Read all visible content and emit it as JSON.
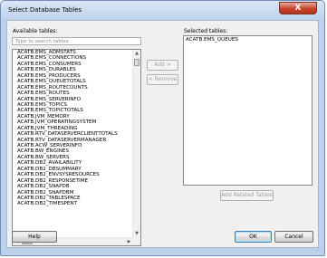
{
  "window": {
    "title": "Select Database Tables",
    "close_glyph": "X"
  },
  "available": {
    "label": "Available tables:",
    "search_placeholder": "Type to search tables",
    "items": [
      "ACATB.EMS_ADMSTATS",
      "ACATB.EMS_CONNECTIONS",
      "ACATB.EMS_CONSUMERS",
      "ACATB.EMS_DURABLES",
      "ACATB.EMS_PRODUCERS",
      "ACATB.EMS_QUEUETOTALS",
      "ACATB.EMS_ROUTECOUNTS",
      "ACATB.EMS_ROUTES",
      "ACATB.EMS_SERVERINFO",
      "ACATB.EMS_TOPICS",
      "ACATB.EMS_TOPICTOTALS",
      "ACATB.JVM_MEMORY",
      "ACATB.JVM_OPERATINGSYSTEM",
      "ACATB.JVM_THREADING",
      "ACATB.RTV_DATASERVERCLIENTTOTALS",
      "ACATB.RTV_DATASERVERMANAGER",
      "ACATB.ACW_SERVERINFO",
      "ACATB.BW_ENGINES",
      "ACATB.BW_SERVERS",
      "ACATB.DB2_AVAILABILITY",
      "ACATB.DB2_DBSUMMARY",
      "ACATB.DB2_ENVSYSRESOURCES",
      "ACATB.DB2_RESPONSETIME",
      "ACATB.DB2_SNAPDB",
      "ACATB.DB2_SNAPDBM",
      "ACATB.DB2_TABLESPACE",
      "ACATB.DB2_TIMESPENT"
    ],
    "hscroll_thumb_glyph": "|||"
  },
  "buttons": {
    "add": "Add >",
    "remove": "< Remove",
    "add_related": "Add Related Tables",
    "help": "Help",
    "ok": "OK",
    "cancel": "Cancel"
  },
  "selected": {
    "label": "Selected tables:",
    "items": [
      "ACATB.EMS_QUEUES"
    ]
  }
}
